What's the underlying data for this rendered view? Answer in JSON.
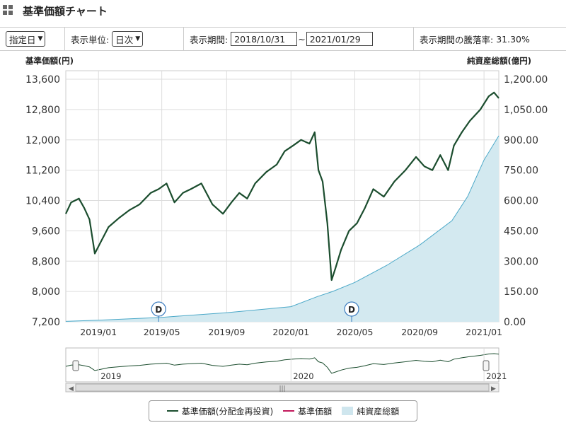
{
  "header": {
    "title": "基準価額チャート",
    "icon": "grid-icon"
  },
  "controls": {
    "date_mode": "指定日",
    "unit_label": "表示単位:",
    "unit_value": "日次",
    "period_label": "表示期間:",
    "period_start": "2018/10/31",
    "period_sep": "~",
    "period_end": "2021/01/29",
    "change_label": "表示期間の騰落率:",
    "change_value": "31.30%"
  },
  "axes": {
    "left_title": "基準価額(円)",
    "right_title": "純資産総額(億円)",
    "left_ticks": [
      "13,600",
      "12,800",
      "12,000",
      "11,200",
      "10,400",
      "9,600",
      "8,800",
      "8,000",
      "7,200"
    ],
    "right_ticks": [
      "1,200.00",
      "1,050.00",
      "900.00",
      "750.00",
      "600.00",
      "450.00",
      "300.00",
      "150.00",
      "0.00"
    ],
    "x_ticks": [
      "2019/01",
      "2019/05",
      "2019/09",
      "2020/01",
      "2020/05",
      "2020/09",
      "2021/01"
    ],
    "navigator_ticks": [
      "2019",
      "2020",
      "2021"
    ]
  },
  "markers": [
    {
      "label": "D",
      "date": "2019/04/25"
    },
    {
      "label": "D",
      "date": "2020/04/25"
    }
  ],
  "legend": {
    "items": [
      {
        "label": "基準価額(分配金再投資)",
        "color": "#1b4d2e",
        "kind": "line"
      },
      {
        "label": "基準価額",
        "color": "#c2185b",
        "kind": "line"
      },
      {
        "label": "純資産総額",
        "color": "#cfe6ee",
        "kind": "area"
      }
    ]
  },
  "colors": {
    "price_line": "#1b4d2e",
    "nav_fill": "#d3e9f0",
    "nav_stroke": "#4aa8c8",
    "grid": "#dddddd"
  },
  "chart_data": {
    "type": "line",
    "xlabel": "",
    "ylabel": "基準価額(円)",
    "y2label": "純資産総額(億円)",
    "x_range": [
      "2018/10/31",
      "2021/01/29"
    ],
    "ylim": [
      7200,
      13600
    ],
    "y2lim": [
      0,
      1200
    ],
    "grid": true,
    "legend_placement": "bottom",
    "series": [
      {
        "name": "基準価額(分配金再投資)",
        "axis": "left",
        "points": [
          [
            "2018/10/31",
            10050
          ],
          [
            "2018/11/10",
            10350
          ],
          [
            "2018/11/25",
            10450
          ],
          [
            "2018/12/05",
            10200
          ],
          [
            "2018/12/15",
            9900
          ],
          [
            "2018/12/25",
            9000
          ],
          [
            "2019/01/05",
            9300
          ],
          [
            "2019/01/20",
            9700
          ],
          [
            "2019/02/10",
            9950
          ],
          [
            "2019/03/01",
            10150
          ],
          [
            "2019/03/20",
            10300
          ],
          [
            "2019/04/10",
            10600
          ],
          [
            "2019/04/25",
            10700
          ],
          [
            "2019/05/10",
            10850
          ],
          [
            "2019/05/25",
            10350
          ],
          [
            "2019/06/10",
            10600
          ],
          [
            "2019/06/25",
            10700
          ],
          [
            "2019/07/15",
            10850
          ],
          [
            "2019/08/05",
            10300
          ],
          [
            "2019/08/25",
            10050
          ],
          [
            "2019/09/10",
            10350
          ],
          [
            "2019/09/25",
            10600
          ],
          [
            "2019/10/10",
            10450
          ],
          [
            "2019/10/25",
            10850
          ],
          [
            "2019/11/15",
            11150
          ],
          [
            "2019/12/05",
            11350
          ],
          [
            "2019/12/20",
            11700
          ],
          [
            "2020/01/05",
            11850
          ],
          [
            "2020/01/20",
            12000
          ],
          [
            "2020/02/05",
            11900
          ],
          [
            "2020/02/15",
            12200
          ],
          [
            "2020/02/22",
            11200
          ],
          [
            "2020/03/01",
            10900
          ],
          [
            "2020/03/10",
            9800
          ],
          [
            "2020/03/18",
            8300
          ],
          [
            "2020/03/25",
            8600
          ],
          [
            "2020/04/05",
            9100
          ],
          [
            "2020/04/20",
            9600
          ],
          [
            "2020/05/05",
            9800
          ],
          [
            "2020/05/20",
            10200
          ],
          [
            "2020/06/05",
            10700
          ],
          [
            "2020/06/25",
            10500
          ],
          [
            "2020/07/15",
            10900
          ],
          [
            "2020/08/05",
            11200
          ],
          [
            "2020/08/25",
            11550
          ],
          [
            "2020/09/10",
            11300
          ],
          [
            "2020/09/25",
            11200
          ],
          [
            "2020/10/10",
            11600
          ],
          [
            "2020/10/25",
            11200
          ],
          [
            "2020/11/05",
            11850
          ],
          [
            "2020/11/20",
            12200
          ],
          [
            "2020/12/05",
            12500
          ],
          [
            "2020/12/25",
            12800
          ],
          [
            "2021/01/10",
            13150
          ],
          [
            "2021/01/20",
            13250
          ],
          [
            "2021/01/29",
            13100
          ]
        ]
      },
      {
        "name": "純資産総額",
        "axis": "right",
        "points": [
          [
            "2018/10/31",
            2
          ],
          [
            "2019/01/01",
            8
          ],
          [
            "2019/05/01",
            22
          ],
          [
            "2019/09/01",
            45
          ],
          [
            "2020/01/01",
            75
          ],
          [
            "2020/02/20",
            125
          ],
          [
            "2020/03/20",
            150
          ],
          [
            "2020/05/01",
            195
          ],
          [
            "2020/07/01",
            280
          ],
          [
            "2020/09/01",
            380
          ],
          [
            "2020/11/01",
            500
          ],
          [
            "2020/12/01",
            620
          ],
          [
            "2021/01/01",
            800
          ],
          [
            "2021/01/29",
            920
          ]
        ]
      }
    ]
  }
}
